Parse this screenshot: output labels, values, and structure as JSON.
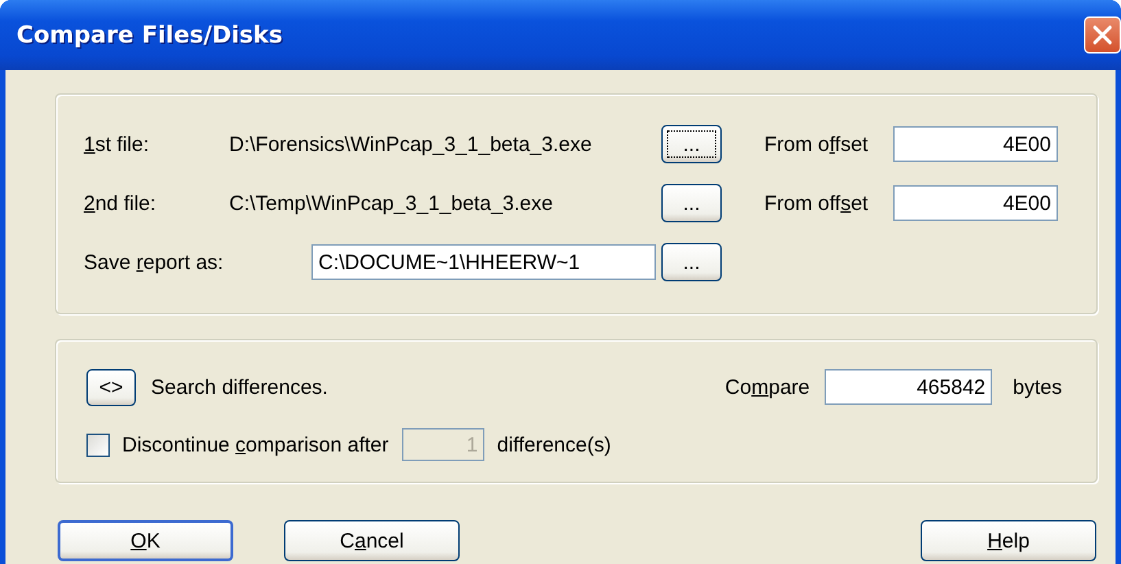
{
  "window": {
    "title": "Compare Files/Disks"
  },
  "file_rows": [
    {
      "label": {
        "key": "1",
        "post": "st file:"
      },
      "path": "D:\\Forensics\\WinPcap_3_1_beta_3.exe",
      "browse": {
        "label": "...",
        "focused": true
      },
      "offset": {
        "label": {
          "pre": "From o",
          "key": "f",
          "post": "fset"
        },
        "value": "4E00"
      }
    },
    {
      "label": {
        "key": "2",
        "post": "nd file:"
      },
      "path": "C:\\Temp\\WinPcap_3_1_beta_3.exe",
      "browse": {
        "label": "...",
        "focused": false
      },
      "offset": {
        "label": {
          "pre": "From off",
          "key": "s",
          "post": "et"
        },
        "value": "4E00"
      }
    }
  ],
  "save_report": {
    "label": {
      "pre": "Save ",
      "key": "r",
      "post": "eport as:"
    },
    "value": "C:\\DOCUME~1\\HHEERW~1",
    "browse": {
      "label": "...",
      "focused": false
    }
  },
  "search": {
    "button_label": "<>",
    "text": "Search differences."
  },
  "compare": {
    "label": {
      "pre": "Co",
      "key": "m",
      "post": "pare"
    },
    "value": "465842",
    "unit": "bytes"
  },
  "discontinue": {
    "checked": false,
    "label": {
      "pre": "Discontinue ",
      "key": "c",
      "post": "omparison after"
    },
    "value": "1",
    "disabled": true,
    "unit": "difference(s)"
  },
  "buttons": [
    {
      "label": {
        "key": "O",
        "post": "K"
      },
      "default": true
    },
    {
      "label": {
        "pre": "C",
        "key": "a",
        "post": "ncel"
      },
      "default": false
    },
    {
      "label": {
        "key": "H",
        "post": "elp"
      },
      "default": false
    }
  ]
}
